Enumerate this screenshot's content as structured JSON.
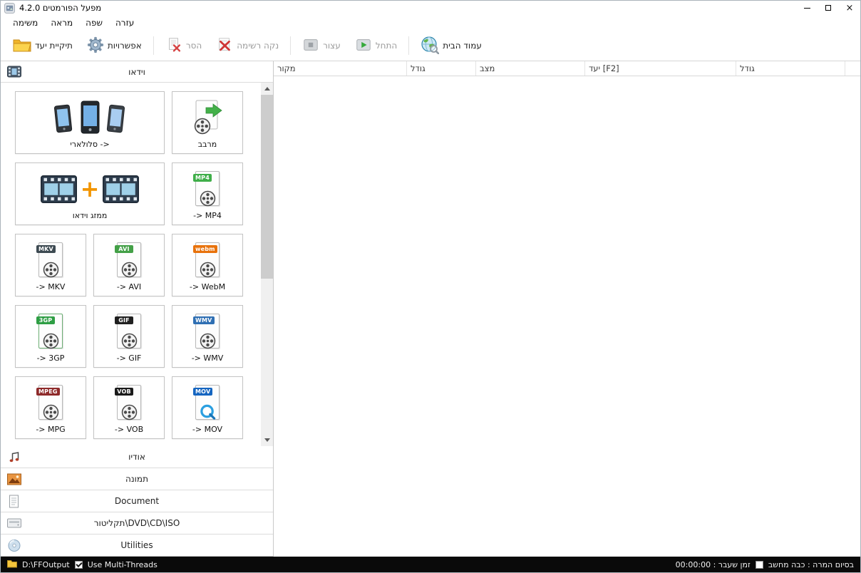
{
  "window": {
    "title": "מפעל הפורמטים 4.2.0"
  },
  "menu": {
    "items": [
      {
        "label": "משימה"
      },
      {
        "label": "מראה"
      },
      {
        "label": "שפה"
      },
      {
        "label": "עזרה"
      }
    ]
  },
  "toolbar": {
    "buttons": [
      {
        "label": "תיקיית יעד",
        "enabled": true
      },
      {
        "label": "אפשרויות",
        "enabled": true
      },
      {
        "label": "הסר",
        "enabled": false
      },
      {
        "label": "נקה רשימה",
        "enabled": false
      },
      {
        "label": "עצור",
        "enabled": false
      },
      {
        "label": "התחל",
        "enabled": false
      },
      {
        "label": "עמוד הבית",
        "enabled": true
      }
    ]
  },
  "task_list": {
    "columns": [
      {
        "label": "מקור"
      },
      {
        "label": "גודל"
      },
      {
        "label": "מצב"
      },
      {
        "label": "יעד [F2]"
      },
      {
        "label": "גודל"
      }
    ]
  },
  "sidebar": {
    "sections": [
      {
        "label": "וידאו"
      },
      {
        "label": "אודיו"
      },
      {
        "label": "תמונה"
      },
      {
        "label": "Document"
      },
      {
        "label": "תקליטור\\DVD\\CD\\ISO"
      },
      {
        "label": "Utilities"
      }
    ],
    "video_buttons": [
      {
        "label": "סלולארי ->"
      },
      {
        "label": "מרבב"
      },
      {
        "label": "ממזג וידאו"
      },
      {
        "label": "-> MP4",
        "badge": "MP4",
        "badge_color": "#3fae49"
      },
      {
        "label": "-> MKV",
        "badge": "MKV",
        "badge_color": "#3d4a52"
      },
      {
        "label": "-> AVI",
        "badge": "AVI",
        "badge_color": "#43a047"
      },
      {
        "label": "-> WebM",
        "badge": "webm",
        "badge_color": "#e8720c"
      },
      {
        "label": "-> 3GP",
        "badge": "3GP",
        "badge_color": "#2e9e44"
      },
      {
        "label": "-> GIF",
        "badge": "GIF",
        "badge_color": "#1f1f1f"
      },
      {
        "label": "-> WMV",
        "badge": "WMV",
        "badge_color": "#2f6fb3"
      },
      {
        "label": "-> MPG",
        "badge": "MPEG",
        "badge_color": "#8e2a2a"
      },
      {
        "label": "-> VOB",
        "badge": "VOB",
        "badge_color": "#1a1a1a"
      },
      {
        "label": "-> MOV",
        "badge": "MOV",
        "badge_color": "#1565c0"
      }
    ]
  },
  "statusbar": {
    "output_path": "D:\\FFOutput",
    "multithreads_label": "Use Multi-Threads",
    "multithreads_checked": true,
    "elapsed_label": "00:00:00 : זמן שעבר",
    "shutdown_label": "בסיום המרה : כבה מחשב",
    "shutdown_checked": false
  }
}
